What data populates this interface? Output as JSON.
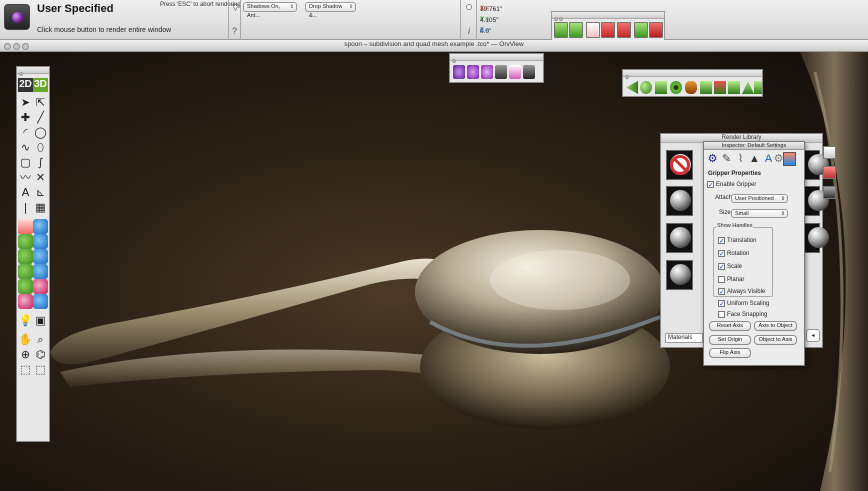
{
  "render_bar": {
    "title": "User Specified",
    "hint_escape": "Press 'ESC' to abort rendering",
    "hint_click": "Click mouse button to render entire window"
  },
  "shadows": {
    "shadows_mode": "Shadows On, Ant...",
    "drop_shadow": "Drop Shadow &...",
    "question": "?",
    "funnel": "▽"
  },
  "coords": {
    "x_label": "X =",
    "x": "19.761\"",
    "y_label": "Y =",
    "y": "4.105\"",
    "z_label": "Z =",
    "z": "0.0\"",
    "info": "i"
  },
  "viewport": {
    "title": "spoon – subdivision and quad mesh example .tco* — OrvView"
  },
  "tool_palette": {
    "mode_2d": "2D",
    "mode_3d": "3D",
    "icons": [
      "arrow",
      "arrow-outline",
      "plus",
      "line",
      "arc",
      "circle",
      "spiral",
      "freehand",
      "rect",
      "curve",
      "bezier",
      "x-shape",
      "text",
      "dimension",
      "vertical-line",
      "hatch"
    ]
  },
  "render_library": {
    "title": "Render Library",
    "materials_label": "Materials",
    "right_button": "◂"
  },
  "inspector": {
    "title": "Inspector: Default Settings",
    "section": "Gripper Properties",
    "enable_gripper": "Enable Gripper",
    "attach_label": "Attach",
    "attach_value": "User Positioned",
    "size_label": "Size",
    "size_value": "Small",
    "show_handles": "Show Handles",
    "translation": "Translation",
    "rotation": "Rotation",
    "scale": "Scale",
    "planar": "Planar",
    "always_visible": "Always Visible",
    "uniform_scaling": "Uniform Scaling",
    "face_snapping": "Face Snapping",
    "buttons": {
      "reset_axis": "Reset Axis",
      "axis_to_object": "Axis to Object",
      "set_origin": "Set Origin",
      "object_to_axis": "Object to Axis",
      "flip_axis": "Flip Axis"
    },
    "checks": {
      "enable_gripper": true,
      "translation": true,
      "rotation": true,
      "scale": true,
      "planar": false,
      "always_visible": true,
      "uniform_scaling": true,
      "face_snapping": false
    }
  },
  "colors": {
    "accent_green": "#6aaa2a",
    "scene_bg": "#2b2116",
    "x_red": "#c62828",
    "y_green": "#2e7d32",
    "z_blue": "#1565c0"
  }
}
